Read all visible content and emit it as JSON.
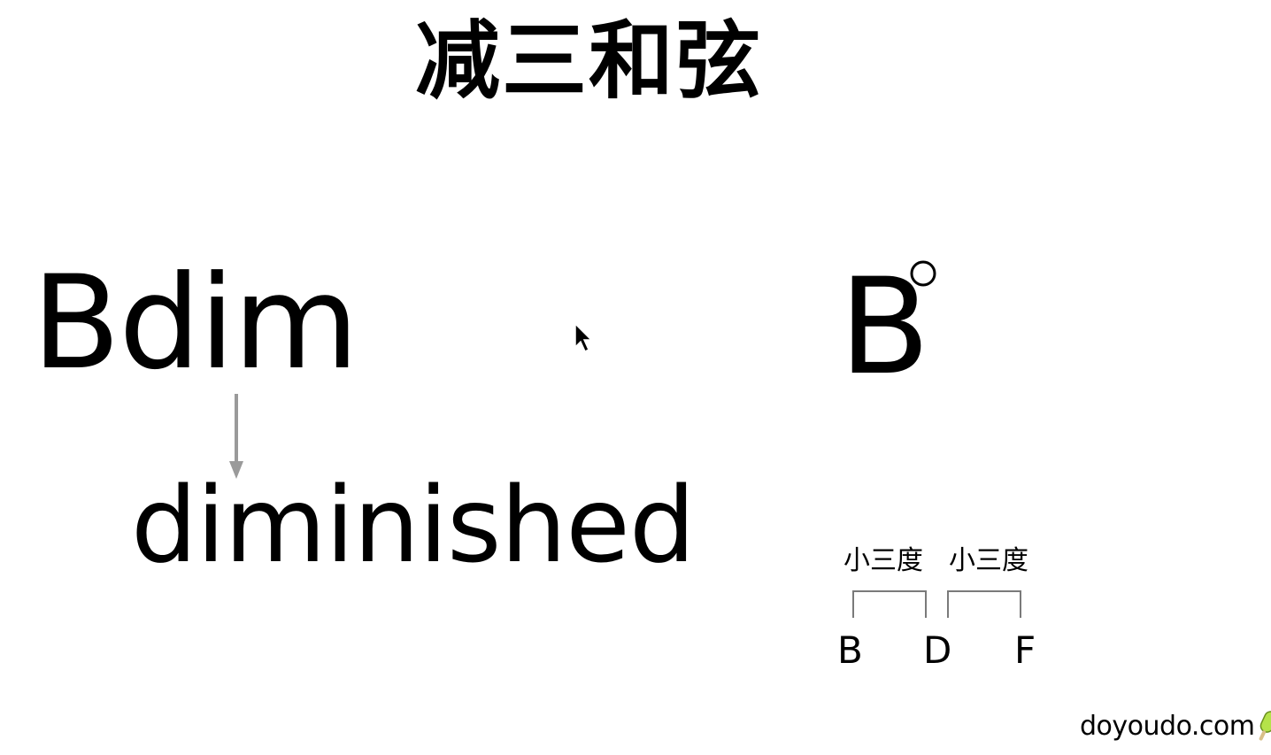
{
  "slide": {
    "title": "减三和弦",
    "chord_name": "Bdim",
    "full_word": "diminished",
    "chord_symbol_letter": "B",
    "degree_icon": "circle-icon"
  },
  "interval_diagram": {
    "intervals": [
      {
        "label": "小三度"
      },
      {
        "label": "小三度"
      }
    ],
    "notes": [
      {
        "name": "B"
      },
      {
        "name": "D"
      },
      {
        "name": "F"
      }
    ]
  },
  "watermark": {
    "text": "doyoudo.com",
    "icon": "popsicle-icon",
    "icon_color": "#b5e34a"
  },
  "colors": {
    "arrow": "#9a9a9a",
    "text": "#000000",
    "background": "#ffffff"
  }
}
